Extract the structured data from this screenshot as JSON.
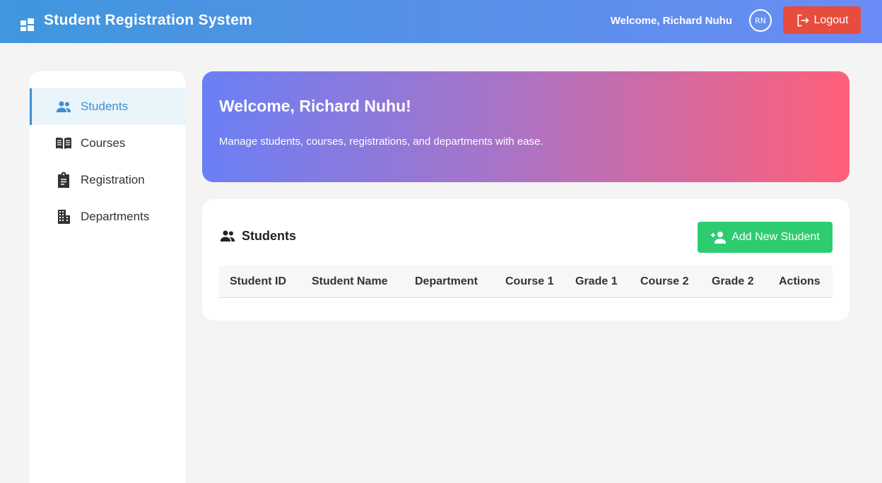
{
  "header": {
    "title": "Student Registration System",
    "welcome": "Welcome, Richard Nuhu",
    "avatar_initials": "RN",
    "logout_label": "Logout",
    "logo_icon": "dashboard-icon",
    "logout_icon": "logout-icon"
  },
  "sidebar": {
    "items": [
      {
        "label": "Students",
        "icon": "people-icon",
        "active": true
      },
      {
        "label": "Courses",
        "icon": "book-icon",
        "active": false
      },
      {
        "label": "Registration",
        "icon": "clipboard-icon",
        "active": false
      },
      {
        "label": "Departments",
        "icon": "building-icon",
        "active": false
      }
    ]
  },
  "hero": {
    "title": "Welcome, Richard Nuhu!",
    "subtitle": "Manage students, courses, registrations, and departments with ease."
  },
  "students_panel": {
    "title": "Students",
    "icon": "people-icon",
    "add_button": "Add New Student",
    "add_icon": "person-add-icon",
    "columns": [
      "Student ID",
      "Student Name",
      "Department",
      "Course 1",
      "Grade 1",
      "Course 2",
      "Grade 2",
      "Actions"
    ],
    "rows": []
  },
  "colors": {
    "accent": "#3b8fd4",
    "logout": "#e74c3c",
    "add": "#2ecc71"
  }
}
